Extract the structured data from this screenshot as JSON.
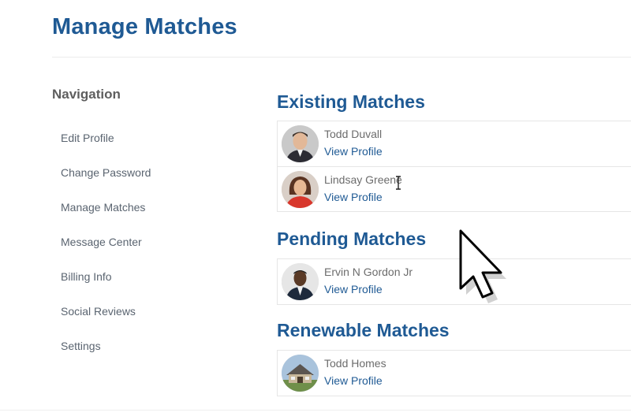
{
  "page": {
    "title": "Manage Matches"
  },
  "navigation": {
    "heading": "Navigation",
    "items": [
      {
        "label": "Edit Profile"
      },
      {
        "label": "Change Password"
      },
      {
        "label": "Manage Matches"
      },
      {
        "label": "Message Center"
      },
      {
        "label": "Billing Info"
      },
      {
        "label": "Social Reviews"
      },
      {
        "label": "Settings"
      }
    ]
  },
  "sections": {
    "existing": {
      "title": "Existing Matches",
      "rows": [
        {
          "name": "Todd Duvall",
          "link": "View Profile",
          "avatar": "person-photo"
        },
        {
          "name": "Lindsay Greene",
          "link": "View Profile",
          "avatar": "person-photo"
        }
      ]
    },
    "pending": {
      "title": "Pending Matches",
      "rows": [
        {
          "name": "Ervin N Gordon Jr",
          "link": "View Profile",
          "avatar": "person-photo"
        }
      ]
    },
    "renewable": {
      "title": "Renewable Matches",
      "rows": [
        {
          "name": "Todd Homes",
          "link": "View Profile",
          "avatar": "house-photo"
        }
      ]
    }
  },
  "colors": {
    "accent": "#1f5a94",
    "muted_text": "#5a6470",
    "border": "#e6e6e6"
  }
}
